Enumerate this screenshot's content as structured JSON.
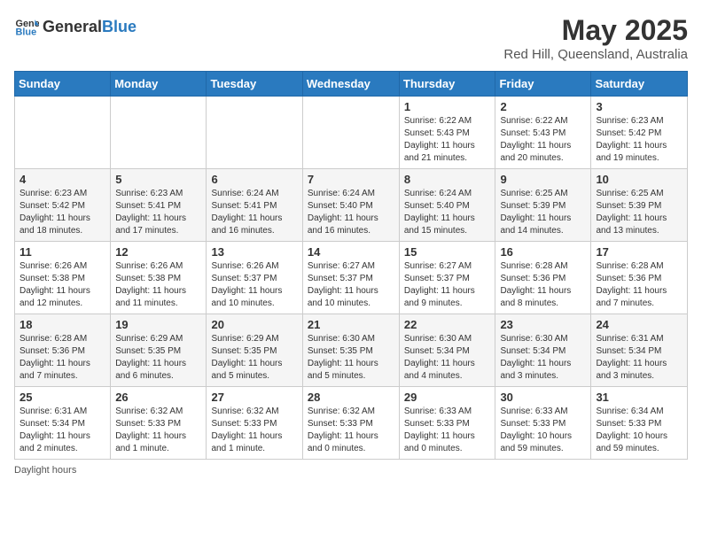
{
  "header": {
    "logo_general": "General",
    "logo_blue": "Blue",
    "title": "May 2025",
    "subtitle": "Red Hill, Queensland, Australia"
  },
  "weekdays": [
    "Sunday",
    "Monday",
    "Tuesday",
    "Wednesday",
    "Thursday",
    "Friday",
    "Saturday"
  ],
  "weeks": [
    [
      {
        "day": "",
        "info": ""
      },
      {
        "day": "",
        "info": ""
      },
      {
        "day": "",
        "info": ""
      },
      {
        "day": "",
        "info": ""
      },
      {
        "day": "1",
        "info": "Sunrise: 6:22 AM\nSunset: 5:43 PM\nDaylight: 11 hours and 21 minutes."
      },
      {
        "day": "2",
        "info": "Sunrise: 6:22 AM\nSunset: 5:43 PM\nDaylight: 11 hours and 20 minutes."
      },
      {
        "day": "3",
        "info": "Sunrise: 6:23 AM\nSunset: 5:42 PM\nDaylight: 11 hours and 19 minutes."
      }
    ],
    [
      {
        "day": "4",
        "info": "Sunrise: 6:23 AM\nSunset: 5:42 PM\nDaylight: 11 hours and 18 minutes."
      },
      {
        "day": "5",
        "info": "Sunrise: 6:23 AM\nSunset: 5:41 PM\nDaylight: 11 hours and 17 minutes."
      },
      {
        "day": "6",
        "info": "Sunrise: 6:24 AM\nSunset: 5:41 PM\nDaylight: 11 hours and 16 minutes."
      },
      {
        "day": "7",
        "info": "Sunrise: 6:24 AM\nSunset: 5:40 PM\nDaylight: 11 hours and 16 minutes."
      },
      {
        "day": "8",
        "info": "Sunrise: 6:24 AM\nSunset: 5:40 PM\nDaylight: 11 hours and 15 minutes."
      },
      {
        "day": "9",
        "info": "Sunrise: 6:25 AM\nSunset: 5:39 PM\nDaylight: 11 hours and 14 minutes."
      },
      {
        "day": "10",
        "info": "Sunrise: 6:25 AM\nSunset: 5:39 PM\nDaylight: 11 hours and 13 minutes."
      }
    ],
    [
      {
        "day": "11",
        "info": "Sunrise: 6:26 AM\nSunset: 5:38 PM\nDaylight: 11 hours and 12 minutes."
      },
      {
        "day": "12",
        "info": "Sunrise: 6:26 AM\nSunset: 5:38 PM\nDaylight: 11 hours and 11 minutes."
      },
      {
        "day": "13",
        "info": "Sunrise: 6:26 AM\nSunset: 5:37 PM\nDaylight: 11 hours and 10 minutes."
      },
      {
        "day": "14",
        "info": "Sunrise: 6:27 AM\nSunset: 5:37 PM\nDaylight: 11 hours and 10 minutes."
      },
      {
        "day": "15",
        "info": "Sunrise: 6:27 AM\nSunset: 5:37 PM\nDaylight: 11 hours and 9 minutes."
      },
      {
        "day": "16",
        "info": "Sunrise: 6:28 AM\nSunset: 5:36 PM\nDaylight: 11 hours and 8 minutes."
      },
      {
        "day": "17",
        "info": "Sunrise: 6:28 AM\nSunset: 5:36 PM\nDaylight: 11 hours and 7 minutes."
      }
    ],
    [
      {
        "day": "18",
        "info": "Sunrise: 6:28 AM\nSunset: 5:36 PM\nDaylight: 11 hours and 7 minutes."
      },
      {
        "day": "19",
        "info": "Sunrise: 6:29 AM\nSunset: 5:35 PM\nDaylight: 11 hours and 6 minutes."
      },
      {
        "day": "20",
        "info": "Sunrise: 6:29 AM\nSunset: 5:35 PM\nDaylight: 11 hours and 5 minutes."
      },
      {
        "day": "21",
        "info": "Sunrise: 6:30 AM\nSunset: 5:35 PM\nDaylight: 11 hours and 5 minutes."
      },
      {
        "day": "22",
        "info": "Sunrise: 6:30 AM\nSunset: 5:34 PM\nDaylight: 11 hours and 4 minutes."
      },
      {
        "day": "23",
        "info": "Sunrise: 6:30 AM\nSunset: 5:34 PM\nDaylight: 11 hours and 3 minutes."
      },
      {
        "day": "24",
        "info": "Sunrise: 6:31 AM\nSunset: 5:34 PM\nDaylight: 11 hours and 3 minutes."
      }
    ],
    [
      {
        "day": "25",
        "info": "Sunrise: 6:31 AM\nSunset: 5:34 PM\nDaylight: 11 hours and 2 minutes."
      },
      {
        "day": "26",
        "info": "Sunrise: 6:32 AM\nSunset: 5:33 PM\nDaylight: 11 hours and 1 minute."
      },
      {
        "day": "27",
        "info": "Sunrise: 6:32 AM\nSunset: 5:33 PM\nDaylight: 11 hours and 1 minute."
      },
      {
        "day": "28",
        "info": "Sunrise: 6:32 AM\nSunset: 5:33 PM\nDaylight: 11 hours and 0 minutes."
      },
      {
        "day": "29",
        "info": "Sunrise: 6:33 AM\nSunset: 5:33 PM\nDaylight: 11 hours and 0 minutes."
      },
      {
        "day": "30",
        "info": "Sunrise: 6:33 AM\nSunset: 5:33 PM\nDaylight: 10 hours and 59 minutes."
      },
      {
        "day": "31",
        "info": "Sunrise: 6:34 AM\nSunset: 5:33 PM\nDaylight: 10 hours and 59 minutes."
      }
    ]
  ],
  "footer": {
    "daylight_label": "Daylight hours"
  }
}
